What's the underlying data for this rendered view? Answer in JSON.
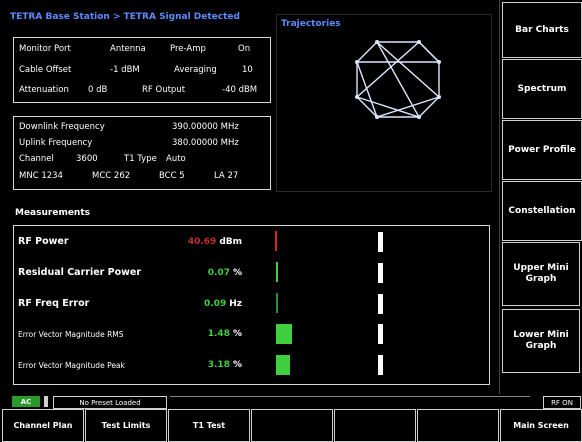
{
  "header": {
    "title": "TETRA Base Station > TETRA Signal Detected"
  },
  "config": {
    "monitor_port_label": "Monitor Port",
    "monitor_port_value": "Antenna",
    "preamp_label": "Pre-Amp",
    "preamp_value": "On",
    "cable_offset_label": "Cable Offset",
    "cable_offset_value": "-1 dBM",
    "averaging_label": "Averaging",
    "averaging_value": "10",
    "attenuation_label": "Attenuation",
    "attenuation_value": "0 dB",
    "rf_output_label": "RF Output",
    "rf_output_value": "-40 dBM"
  },
  "frequency": {
    "downlink_label": "Downlink Frequency",
    "downlink_value": "390.00000 MHz",
    "uplink_label": "Uplink Frequency",
    "uplink_value": "380.00000 MHz",
    "channel_label": "Channel",
    "channel_value": "3600",
    "t1_type_label": "T1 Type",
    "t1_type_value": "Auto",
    "mnc": "MNC 1234",
    "mcc": "MCC 262",
    "bcc": "BCC 5",
    "la": "LA 27"
  },
  "trajectories": {
    "title": "Trajectories"
  },
  "measurements": {
    "title": "Measurements",
    "rows": [
      {
        "label": "RF Power",
        "value": "40.69",
        "unit": "dBm",
        "value_color": "#c03030"
      },
      {
        "label": "Residual Carrier Power",
        "value": "0.07",
        "unit": "%",
        "value_color": "#3fcf3f"
      },
      {
        "label": "RF Freq Error",
        "value": "0.09",
        "unit": "Hz",
        "value_color": "#3fcf3f"
      },
      {
        "label": "Error Vector Magnitude RMS",
        "value": "1.48",
        "unit": "%",
        "value_color": "#3fcf3f"
      },
      {
        "label": "Error Vector Magnitude Peak",
        "value": "3.18",
        "unit": "%",
        "value_color": "#3fcf3f"
      }
    ]
  },
  "softkeys": {
    "bar_charts": "Bar Charts",
    "spectrum": "Spectrum",
    "power_profile": "Power Profile",
    "constellation": "Constellation",
    "upper_mini_graph": "Upper Mini Graph",
    "lower_mini_graph": "Lower Mini Graph"
  },
  "status_bar": {
    "ac": "AC",
    "preset": "No Preset Loaded",
    "rf": "RF ON"
  },
  "bottom_menu": {
    "channel_plan": "Channel Plan",
    "test_limits": "Test Limits",
    "t1_test": "T1 Test",
    "main_screen": "Main Screen"
  },
  "colors": {
    "accent": "#5b8cff",
    "good": "#3fcf3f",
    "alert": "#c03030"
  }
}
